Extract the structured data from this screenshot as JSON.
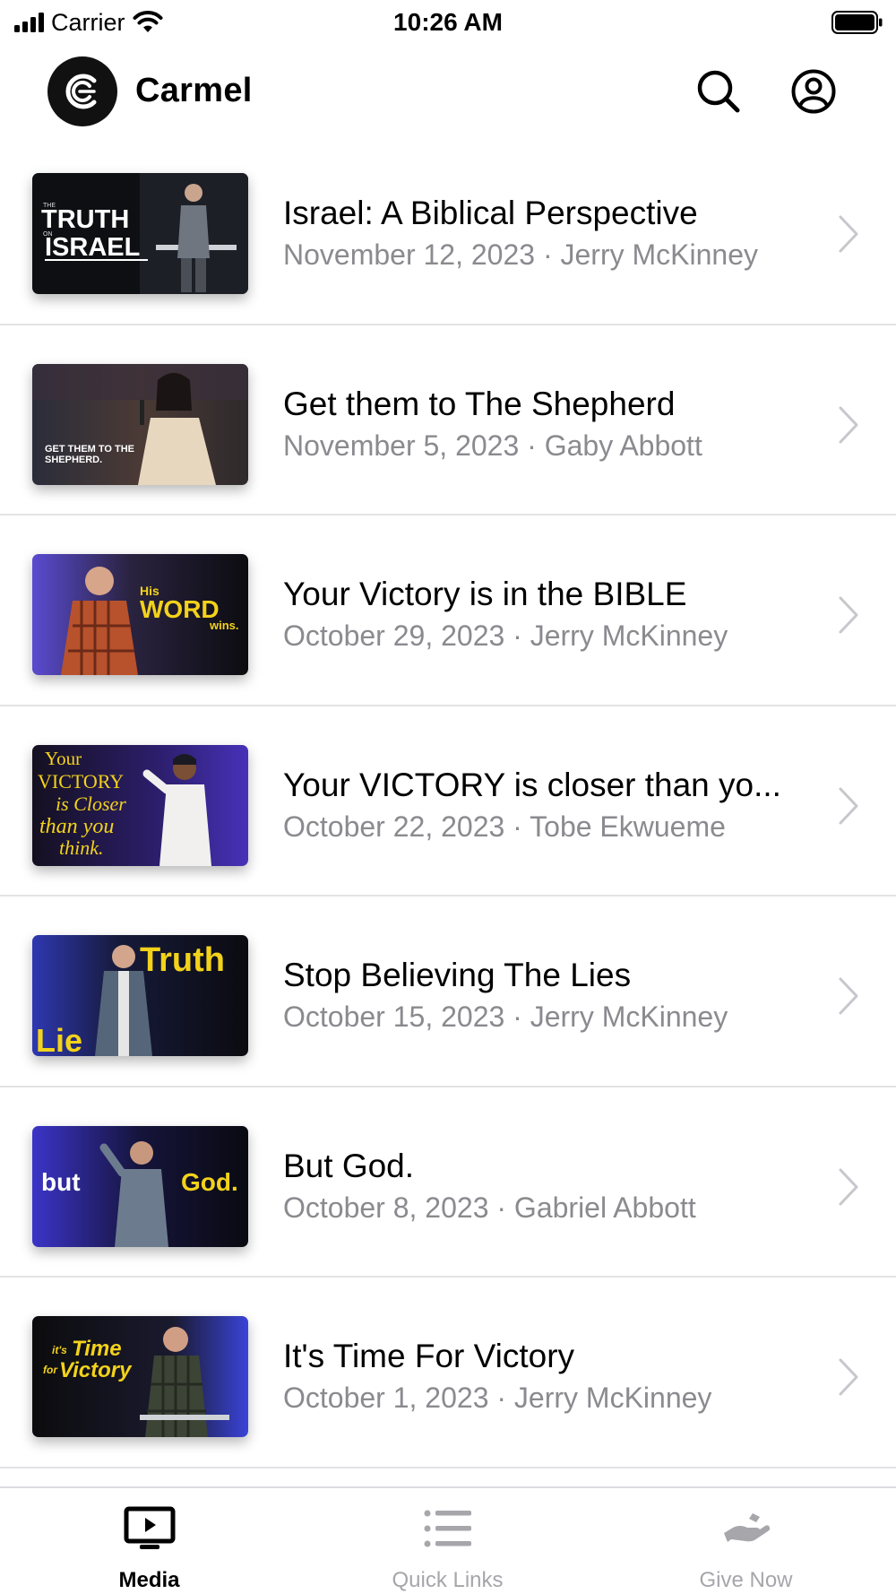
{
  "status_bar": {
    "carrier": "Carrier",
    "time": "10:26 AM"
  },
  "header": {
    "brand": "Carmel",
    "icons": [
      "carmel-logo-icon",
      "search-icon",
      "account-icon"
    ]
  },
  "media_list": [
    {
      "title": "Israel: A Biblical Perspective",
      "subtitle": "November 12, 2023 · Jerry McKinney",
      "thumb_text": [
        "THE",
        "TRUTH",
        "ON",
        "ISRAEL"
      ]
    },
    {
      "title": "Get them to The Shepherd",
      "subtitle": "November 5, 2023 · Gaby Abbott",
      "thumb_text": [
        "GET THEM TO THE",
        "SHEPHERD."
      ]
    },
    {
      "title": "Your Victory is in the BIBLE",
      "subtitle": "October 29, 2023 · Jerry McKinney",
      "thumb_text": [
        "His",
        "WORD",
        "wins."
      ]
    },
    {
      "title": "Your VICTORY is closer than yo...",
      "subtitle": "October 22, 2023 · Tobe Ekwueme",
      "thumb_text": [
        "Your",
        "VICTORY",
        "is Closer",
        "than you",
        "think."
      ]
    },
    {
      "title": "Stop Believing The Lies",
      "subtitle": "October 15, 2023 · Jerry McKinney",
      "thumb_text": [
        "Truth",
        "Lie"
      ]
    },
    {
      "title": "But God.",
      "subtitle": "October 8, 2023 · Gabriel Abbott",
      "thumb_text": [
        "but",
        "God."
      ]
    },
    {
      "title": "It's Time For Victory",
      "subtitle": "October 1, 2023 · Jerry McKinney",
      "thumb_text": [
        "it's",
        "Time",
        "for",
        "Victory"
      ]
    }
  ],
  "tab_bar": {
    "tabs": [
      {
        "label": "Media",
        "icon": "media-tv-icon",
        "active": true
      },
      {
        "label": "Quick Links",
        "icon": "list-icon",
        "active": false
      },
      {
        "label": "Give Now",
        "icon": "give-hand-icon",
        "active": false
      }
    ]
  },
  "colors": {
    "text_primary": "#000000",
    "text_secondary": "#8a8a8f",
    "separator": "#e3e3e6",
    "tab_inactive": "#a6a6ab",
    "thumb_yellow": "#f3d21a"
  }
}
